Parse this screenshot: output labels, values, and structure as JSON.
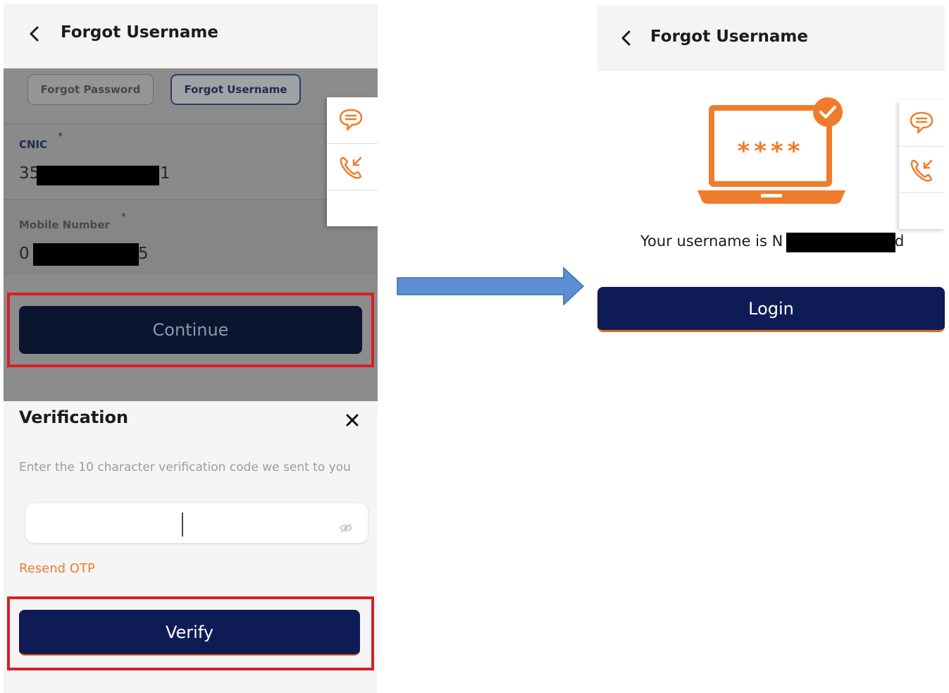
{
  "left_screen": {
    "header": {
      "title": "Forgot Username",
      "back_icon": "chevron-left-icon"
    },
    "tabs": [
      {
        "label": "Forgot Password",
        "selected": false
      },
      {
        "label": "Forgot Username",
        "selected": true
      }
    ],
    "cnic": {
      "label": "CNIC",
      "required_mark": "*",
      "value_prefix": "35",
      "value_suffix": "1",
      "redacted": true
    },
    "mobile": {
      "label": "Mobile Number",
      "required_mark": "*",
      "value_prefix": "0",
      "value_suffix": "5",
      "redacted": true
    },
    "continue_label": "Continue",
    "side_panel": {
      "icons": [
        "chat-icon",
        "phone-callback-icon"
      ]
    },
    "verification_sheet": {
      "title": "Verification",
      "description": "Enter the 10 character verification code we sent to you",
      "code_value": "",
      "resend_label": "Resend OTP",
      "verify_label": "Verify"
    }
  },
  "right_screen": {
    "header": {
      "title": "Forgot Username",
      "back_icon": "chevron-left-icon"
    },
    "illustration": {
      "masked_text": "****",
      "icon": "laptop-password-check-icon"
    },
    "message_prefix": "Your username is N",
    "message_suffix": "d",
    "login_label": "Login",
    "side_panel": {
      "icons": [
        "chat-icon",
        "phone-callback-icon"
      ]
    }
  },
  "colors": {
    "primary_navy": "#0f1b55",
    "accent_orange": "#f07c2b",
    "highlight_red": "#d81f2a",
    "arrow_blue": "#5b8fd1"
  }
}
